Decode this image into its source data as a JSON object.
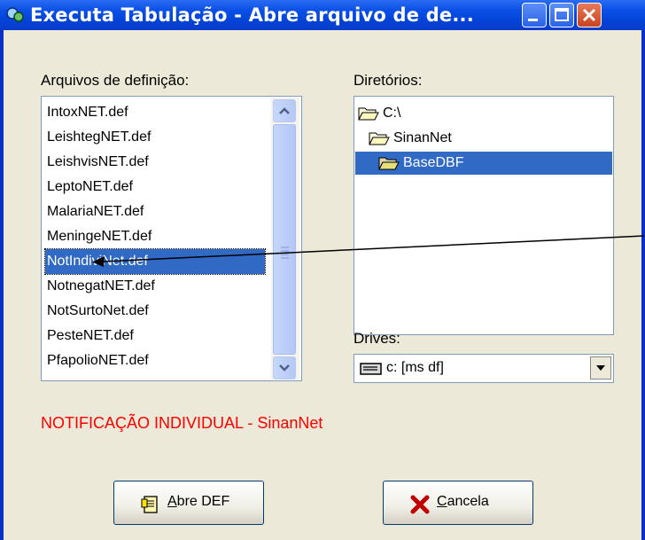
{
  "window": {
    "title": "Executa Tabulação - Abre arquivo de de..."
  },
  "files": {
    "label": "Arquivos de definição:",
    "items": [
      "IntoxNET.def",
      "LeishtegNET.def",
      "LeishvisNET.def",
      "LeptoNET.def",
      "MalariaNET.def",
      "MeningeNET.def",
      "NotIndiviNet.def",
      "NotnegatNET.def",
      "NotSurtoNet.def",
      "PesteNET.def",
      "PfapolioNET.def"
    ],
    "selected": "NotIndiviNet.def"
  },
  "directories": {
    "label": "Diretórios:",
    "items": [
      "C:\\",
      "SinanNet",
      "BaseDBF"
    ],
    "selected": "BaseDBF"
  },
  "drives": {
    "label": "Drives:",
    "value": "c: [ms df]"
  },
  "status": {
    "text": "NOTIFICAÇÃO INDIVIDUAL - SinanNet",
    "color": "#ff0000"
  },
  "buttons": {
    "open": {
      "accel": "A",
      "rest": "bre DEF",
      "icon": "document-icon"
    },
    "cancel": {
      "accel": "C",
      "rest": "ancela",
      "icon": "red-x-icon"
    }
  },
  "colors": {
    "title_bar": "#0a4fe6",
    "selection": "#316ac5",
    "face": "#ece9d8"
  }
}
